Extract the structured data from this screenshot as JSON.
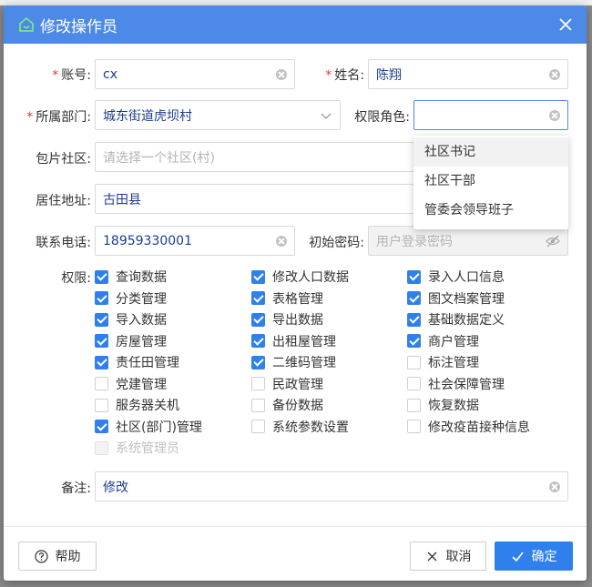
{
  "background": {
    "strip_text": ""
  },
  "dialog": {
    "title": "修改操作员",
    "accent": "#4d8ae8"
  },
  "form": {
    "account": {
      "label": "账号:",
      "value": "cx"
    },
    "name": {
      "label": "姓名:",
      "value": "陈翔"
    },
    "department": {
      "label": "所属部门:",
      "value": "城东街道虎坝村"
    },
    "role": {
      "label": "权限角色:",
      "value": ""
    },
    "community": {
      "label": "包片社区:",
      "placeholder": "请选择一个社区(村)"
    },
    "address": {
      "label": "居住地址:",
      "value": "古田县"
    },
    "phone": {
      "label": "联系电话:",
      "value": "18959330001"
    },
    "password": {
      "label": "初始密码:",
      "placeholder": "用户登录密码"
    },
    "remark": {
      "label": "备注:",
      "value": "修改"
    }
  },
  "role_dropdown": {
    "options": [
      "社区书记",
      "社区干部",
      "管委会领导班子"
    ]
  },
  "permissions": {
    "label": "权限:",
    "items": [
      {
        "label": "查询数据",
        "checked": true
      },
      {
        "label": "修改人口数据",
        "checked": true
      },
      {
        "label": "录入人口信息",
        "checked": true
      },
      {
        "label": "分类管理",
        "checked": true
      },
      {
        "label": "表格管理",
        "checked": true
      },
      {
        "label": "图文档案管理",
        "checked": true
      },
      {
        "label": "导入数据",
        "checked": true
      },
      {
        "label": "导出数据",
        "checked": true
      },
      {
        "label": "基础数据定义",
        "checked": true
      },
      {
        "label": "房屋管理",
        "checked": true
      },
      {
        "label": "出租屋管理",
        "checked": true
      },
      {
        "label": "商户管理",
        "checked": true
      },
      {
        "label": "责任田管理",
        "checked": true
      },
      {
        "label": "二维码管理",
        "checked": true
      },
      {
        "label": "标注管理",
        "checked": false
      },
      {
        "label": "党建管理",
        "checked": false
      },
      {
        "label": "民政管理",
        "checked": false
      },
      {
        "label": "社会保障管理",
        "checked": false
      },
      {
        "label": "服务器关机",
        "checked": false
      },
      {
        "label": "备份数据",
        "checked": false
      },
      {
        "label": "恢复数据",
        "checked": false
      },
      {
        "label": "社区(部门)管理",
        "checked": true
      },
      {
        "label": "系统参数设置",
        "checked": false
      },
      {
        "label": "修改疫苗接种信息",
        "checked": false
      },
      {
        "label": "系统管理员",
        "checked": false,
        "disabled": true
      }
    ]
  },
  "footer": {
    "help": "帮助",
    "cancel": "取消",
    "confirm": "确定"
  }
}
